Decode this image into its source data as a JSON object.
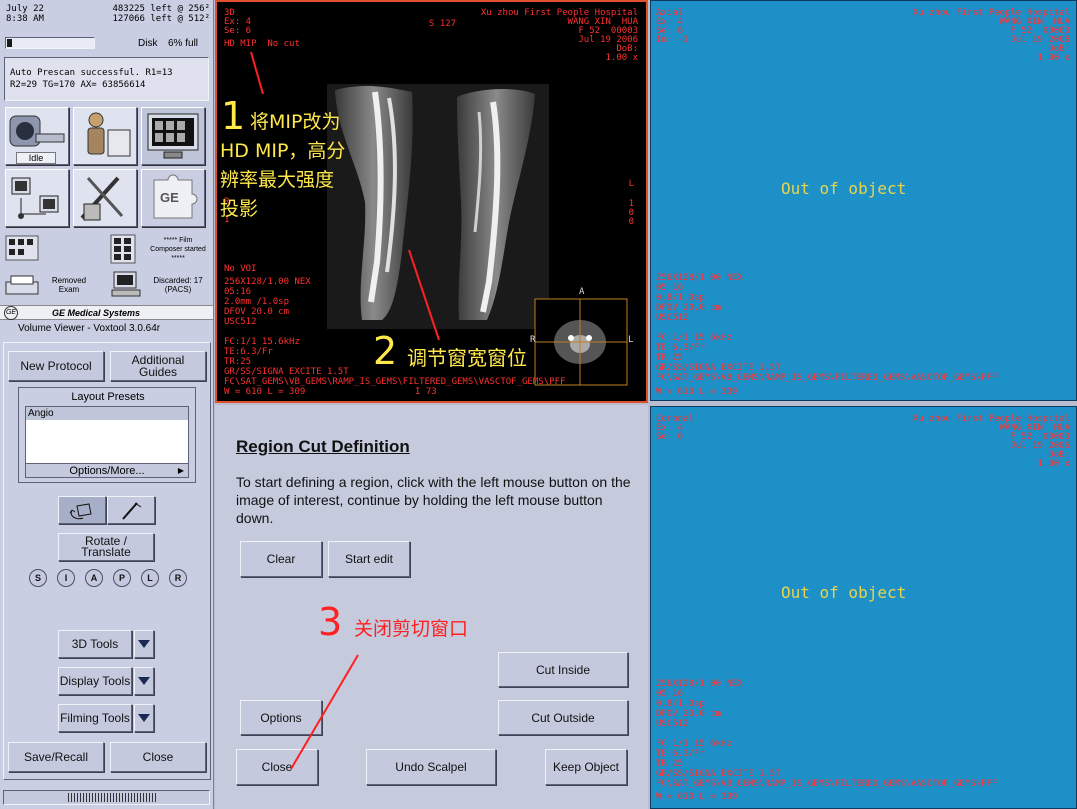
{
  "status": {
    "date": "July 22",
    "time": "8:38 AM",
    "images_left_1": "483225 left @ 256²",
    "images_left_2": "127066 left @ 512²",
    "disk_label": "Disk",
    "disk_pct": "6% full",
    "disk_fill": 0.06,
    "message_1": "Auto Prescan successful.  R1=13",
    "message_2": "R2=29  TG=170  AX= 63856614",
    "idle": "Idle",
    "film_composer": "***** Film Composer started *****",
    "removed_exam": "Removed Exam",
    "discarded": "Discarded: 17 (PACS)",
    "company": "GE Medical Systems",
    "app_title": "Volume Viewer - Voxtool 3.0.64r",
    "gamma_icon": "GE"
  },
  "left_panel": {
    "new_protocol": "New Protocol",
    "additional_guides": "Additional Guides",
    "layout_presets": "Layout Presets",
    "preset_selected": "Angio",
    "options_more": "Options/More...",
    "rotate_translate": "Rotate / Translate",
    "orient": [
      "S",
      "I",
      "A",
      "P",
      "L",
      "R"
    ],
    "tools_3d": "3D Tools",
    "display_tools": "Display Tools",
    "filming_tools": "Filming Tools",
    "save_recall": "Save/Recall",
    "close": "Close"
  },
  "viewport_3d": {
    "tl": "3D\nEx: 4\nSe: 6\n",
    "mode": "HD MIP  No cut",
    "tr": "Xu zhou First People Hospital\nWANG XIN  HUA\nF 52  00003\nJul 19 2006\nDoB:\n1.00 x",
    "s_label": "S 127",
    "bl_novoi": "No VOI",
    "bl": "256X128/1.00 NEX\n05:16\n2.0mm /1.0sp\nDFOV 20.0 cm\nUSC512\n\nFC:1/1 15.6kHz\nTE:6.3/Fr\nTR:25\nGR/SS/SIGNA EXCITE 1.5T\nFC\\SAT_GEMS\\VB_GEMS\\RAMP_IS_GEMS\\FILTERED_GEMS\\VASCTOF_GEMS\\PFF",
    "wl": "W = 610 L = 309",
    "i_label": "I 73",
    "side_L": "L",
    "side_nums": "1\n0\n0",
    "side_left": "R\n\n1",
    "inset_A": "A",
    "inset_R": "R",
    "inset_L": "L"
  },
  "viewport_axial": {
    "tl": "Axial\nEx: 4\nSe: 6\nIm: -1",
    "tr": "Xu zhou First People Hospital\nWANG XIN  HUA\nF 52  00003\nJul 19 2006\nDoB:\n1.00 x",
    "center": "Out of object",
    "bl": "256X128/1.00 NEX\n05:16\n0.8/1.0sp\nDFOV 20.0 cm\nUSC512\n\nFC:1/1 15.6kHz\nTE:6.3/Fr\nTR:25\nGR/SS/SIGNA EXCITE 1.5T\nFC\\SAT_GEMS\\VB_GEMS\\RAMP_IS_GEMS\\FILTERED_GEMS\\VASCTOF_GEMS\\PFF",
    "wl": "W = 610 L = 309"
  },
  "viewport_coronal": {
    "tl": "Coronal\nEx: 4\nSe: 6",
    "tr": "Xu zhou First People Hospital\nWANG XIN  HUA\nF 52  00003\nJul 19 2006\nDoB:\n1.00 x",
    "center": "Out of object",
    "bl": "256X128/1.00 NEX\n05:16\n0.8/1.0sp\nDFOV 20.0 cm\nUSC512\n\nFC:1/1 15.6kHz\nTE:6.3/Fr\nTR:25\nGR/SS/SIGNA EXCITE 1.5T\nFC\\SAT_GEMS\\VB_GEMS\\RAMP_IS_GEMS\\FILTERED_GEMS\\VASCTOF_GEMS\\PFF",
    "wl": "W = 610 L = 309"
  },
  "region_cut": {
    "title": "Region Cut Definition",
    "instructions": "To start defining a region, click with the left mouse button on the image of interest, continue by holding the left mouse button down.",
    "clear": "Clear",
    "start_edit": "Start edit",
    "cut_inside": "Cut Inside",
    "cut_outside": "Cut Outside",
    "options": "Options",
    "close": "Close",
    "undo_scalpel": "Undo Scalpel",
    "keep_object": "Keep Object"
  },
  "annotations": {
    "n1": "1",
    "t1": "将MIP改为HD MIP，高分辨率最大强度投影",
    "n2": "2",
    "t2": "调节窗宽窗位",
    "n3": "3",
    "t3": "关闭剪切窗口"
  },
  "colors": {
    "panel_bg": "#c9cee2",
    "viewport_blue": "#1e90c8",
    "overlay_red": "#ff3030",
    "annotation_yellow": "#ffe84a",
    "annotation_red": "#ff2020"
  }
}
